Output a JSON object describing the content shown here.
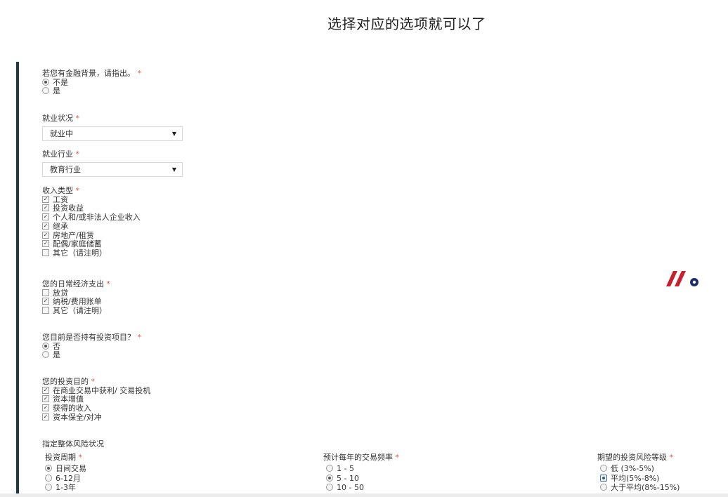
{
  "page_title": "选择对应的选项就可以了",
  "required_marker": "*",
  "financial_background": {
    "label": "若您有金融背景，请指出。",
    "options": [
      {
        "label": "不是",
        "selected": true
      },
      {
        "label": "是",
        "selected": false
      }
    ]
  },
  "employment_status": {
    "label": "就业状况",
    "value": "就业中"
  },
  "employment_industry": {
    "label": "就业行业",
    "value": "教育行业"
  },
  "income_type": {
    "label": "收入类型",
    "options": [
      {
        "label": "工资",
        "checked": true
      },
      {
        "label": "投资收益",
        "checked": true
      },
      {
        "label": "个人和/或非法人企业收入",
        "checked": true
      },
      {
        "label": "继承",
        "checked": true
      },
      {
        "label": "房地产/租赁",
        "checked": true
      },
      {
        "label": "配偶/家庭储蓄",
        "checked": true
      },
      {
        "label": "其它（请注明）",
        "checked": false
      }
    ]
  },
  "daily_expenses": {
    "label": "您的日常经济支出",
    "options": [
      {
        "label": "放贷",
        "checked": false
      },
      {
        "label": "纳税/费用账单",
        "checked": true
      },
      {
        "label": "其它（请注明）",
        "checked": false
      }
    ]
  },
  "holding_investments": {
    "label": "您目前是否持有投资项目？",
    "options": [
      {
        "label": "否",
        "selected": true
      },
      {
        "label": "是",
        "selected": false
      }
    ]
  },
  "investment_purpose": {
    "label": "您的投资目的",
    "options": [
      {
        "label": "在商业交易中获利/ 交易投机",
        "checked": true
      },
      {
        "label": "资本增值",
        "checked": true
      },
      {
        "label": "获得的收入",
        "checked": true
      },
      {
        "label": "资本保全/对冲",
        "checked": true
      }
    ]
  },
  "risk_section_label": "指定整体风险状况",
  "investment_period": {
    "label": "投资周期",
    "options": [
      {
        "label": "日间交易",
        "selected": true
      },
      {
        "label": "6-12月",
        "selected": false
      },
      {
        "label": "1-3年",
        "selected": false
      }
    ]
  },
  "trade_frequency": {
    "label": "预计每年的交易频率",
    "options": [
      {
        "label": "1 - 5",
        "selected": false
      },
      {
        "label": "5 - 10",
        "selected": true
      },
      {
        "label": "10 - 50",
        "selected": false
      }
    ]
  },
  "risk_level": {
    "label": "期望的投资风险等级",
    "options": [
      {
        "label": "低 (3%-5%)",
        "selected": false
      },
      {
        "label": "平均(5%-8%)",
        "selected": true
      },
      {
        "label": "大于平均(8%-15%)",
        "selected": false
      }
    ]
  },
  "colors": {
    "accent_bar": "#1f3a44",
    "required": "#e05a4a",
    "logo_red": "#c8202f",
    "logo_navy": "#1c2f6b"
  }
}
